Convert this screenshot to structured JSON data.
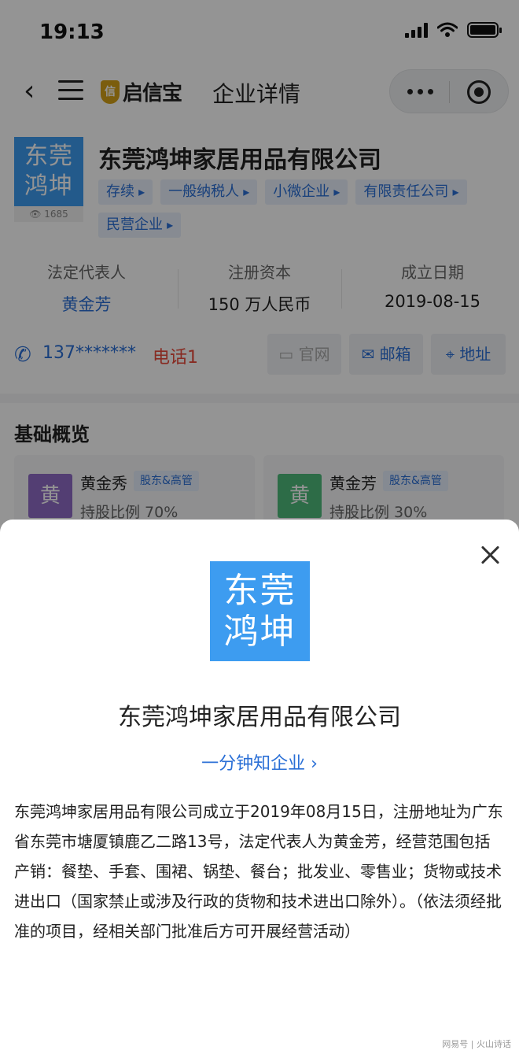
{
  "status_bar": {
    "time": "19:13"
  },
  "nav": {
    "back_glyph": "‹",
    "logo_text": "启信宝",
    "logo_badge": "信",
    "title": "企业详情"
  },
  "company": {
    "logo_text": "东莞\n鸿坤",
    "views": "1685",
    "name": "东莞鸿坤家居用品有限公司",
    "tags": [
      "存续",
      "一般纳税人",
      "小微企业",
      "有限责任公司",
      "民营企业"
    ]
  },
  "stats": [
    {
      "label": "法定代表人",
      "value": "黄金芳"
    },
    {
      "label": "注册资本",
      "value": "150 万人民币"
    },
    {
      "label": "成立日期",
      "value": "2019-08-15"
    }
  ],
  "contact": {
    "phone": "137*******",
    "phone_tag": "电话1",
    "buttons": [
      "官网",
      "邮箱",
      "地址"
    ]
  },
  "overview": {
    "title": "基础概览",
    "shareholders": [
      {
        "avatar": "黄",
        "name": "黄金秀",
        "badge": "股东&高管",
        "ratio": "持股比例  70%",
        "color": "#8f6cc7"
      },
      {
        "avatar": "黄",
        "name": "黄金芳",
        "badge": "股东&高管",
        "ratio": "持股比例  30%",
        "color": "#4fba7a"
      }
    ]
  },
  "sheet": {
    "logo_text": "东莞\n鸿坤",
    "company_name": "东莞鸿坤家居用品有限公司",
    "link": "一分钟知企业 ›",
    "description": "东莞鸿坤家居用品有限公司成立于2019年08月15日，注册地址为广东省东莞市塘厦镇鹿乙二路13号，法定代表人为黄金芳，经营范围包括产销：餐垫、手套、围裙、锅垫、餐台；批发业、零售业；货物或技术进出口（国家禁止或涉及行政的货物和技术进出口除外）。（依法须经批准的项目，经相关部门批准后方可开展经营活动）"
  },
  "watermark": "网易号 | 火山诗话",
  "colors": {
    "accent": "#2a6fd6",
    "logo_bg": "#3d9cf0",
    "phone_tag": "#e84a3c"
  }
}
